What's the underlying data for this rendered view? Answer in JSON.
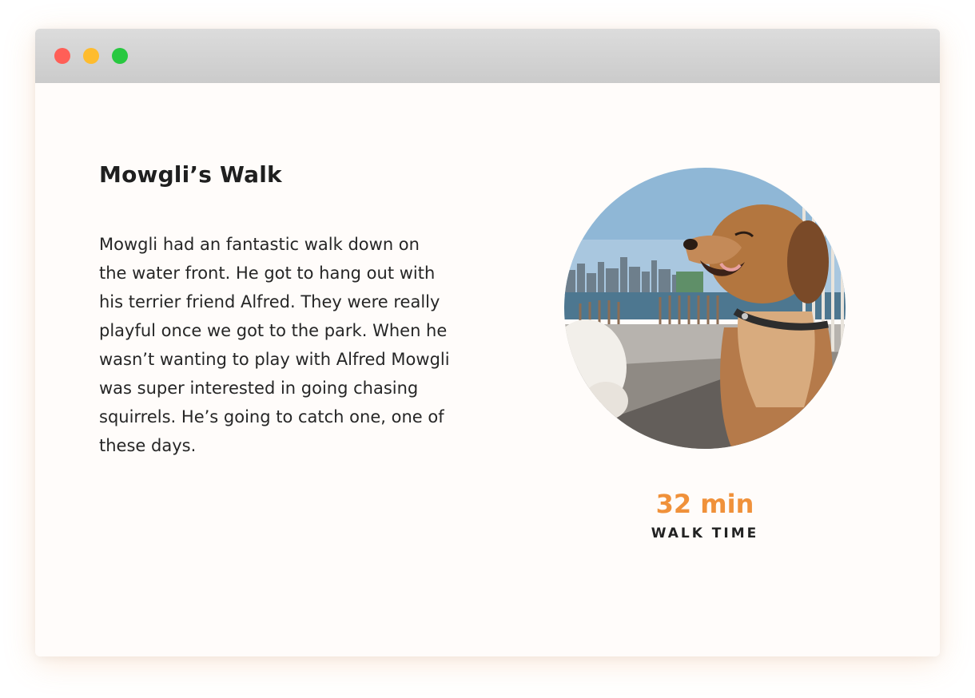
{
  "window": {
    "controls": {
      "close_color": "#ff5f57",
      "minimize_color": "#febc2e",
      "maximize_color": "#28c840"
    }
  },
  "walk": {
    "title": "Mowgli’s Walk",
    "description": "Mowgli had an fantastic walk down on the water front. He got to hang out with his terrier friend Alfred. They were really playful once we got to the park. When he wasn’t wanting to play with Alfred Mowgli was super interested in going chasing squirrels. He’s going to catch one, one of these days.",
    "photo_alt": "Golden retriever sitting on a waterfront path with a city skyline behind",
    "stat": {
      "value": "32 min",
      "label": "WALK TIME",
      "accent_color": "#f0913a"
    }
  }
}
